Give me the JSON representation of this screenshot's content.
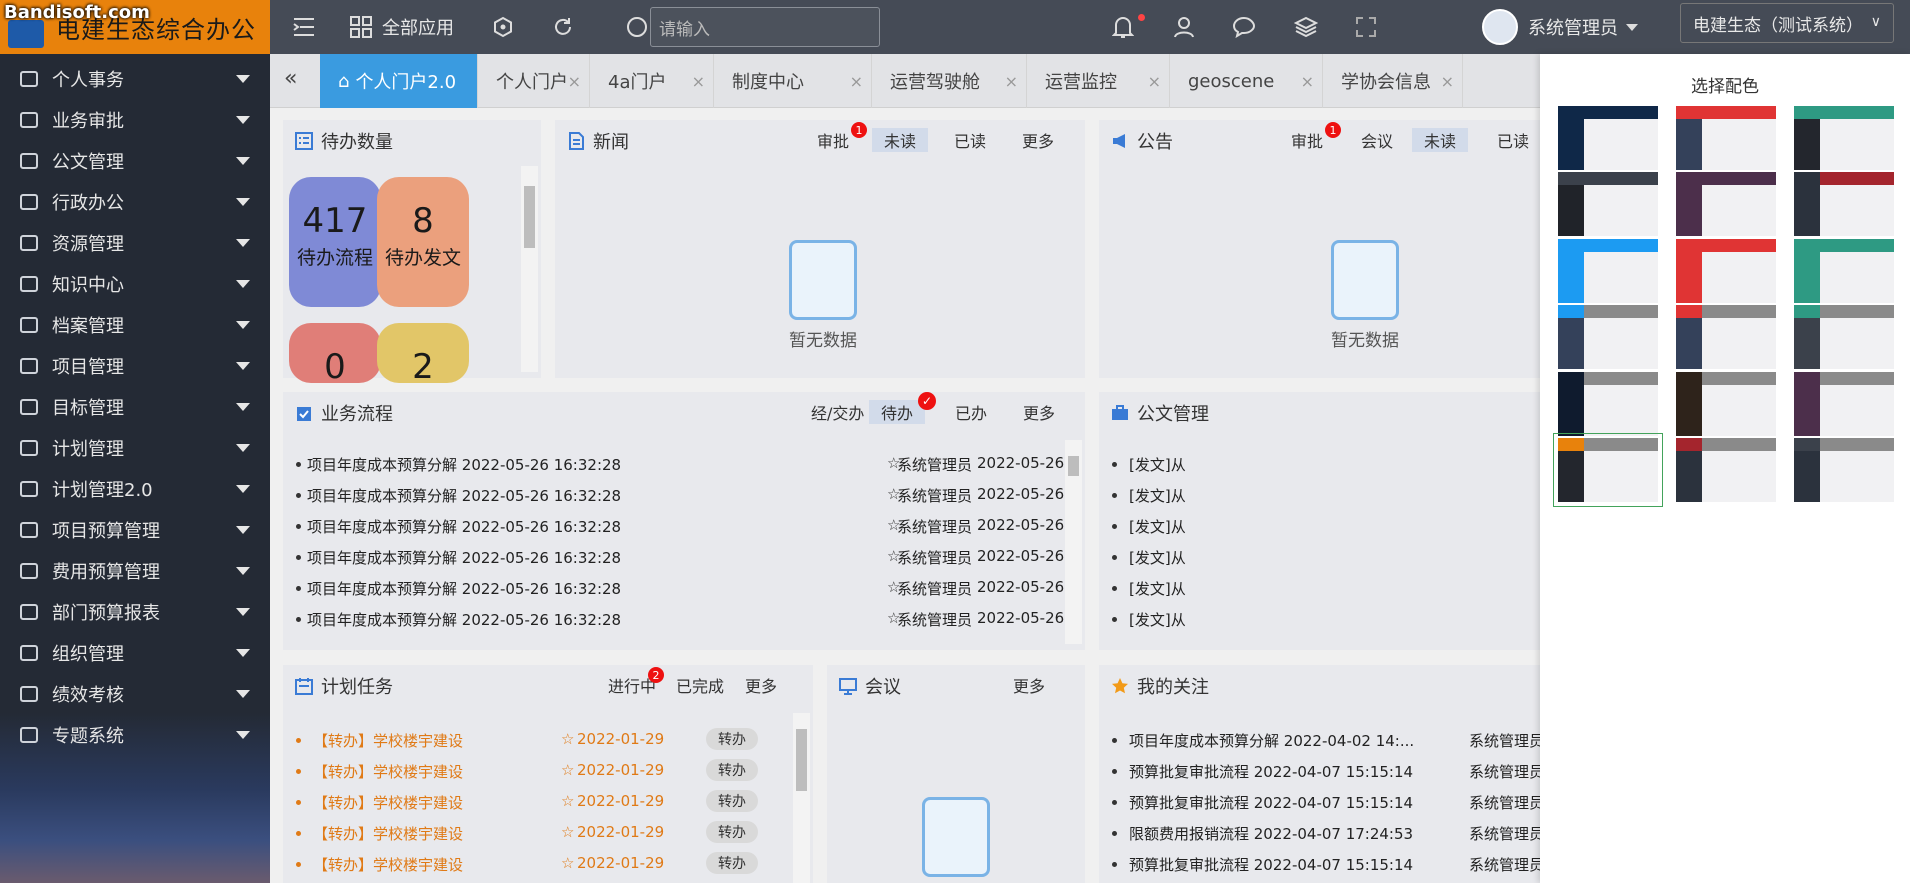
{
  "watermark": "Bandisoft.com",
  "app_title": "电建生态综合办公",
  "topbar": {
    "all_apps": "全部应用",
    "search_placeholder": "请输入",
    "user_name": "系统管理员",
    "system_select": "电建生态（测试系统）"
  },
  "sidebar": {
    "items": [
      {
        "label": "个人事务",
        "icon": "person-icon"
      },
      {
        "label": "业务审批",
        "icon": "approval-icon"
      },
      {
        "label": "公文管理",
        "icon": "document-icon"
      },
      {
        "label": "行政办公",
        "icon": "office-icon"
      },
      {
        "label": "资源管理",
        "icon": "target-icon"
      },
      {
        "label": "知识中心",
        "icon": "knowledge-icon"
      },
      {
        "label": "档案管理",
        "icon": "archive-icon"
      },
      {
        "label": "项目管理",
        "icon": "layers-icon"
      },
      {
        "label": "目标管理",
        "icon": "goal-icon"
      },
      {
        "label": "计划管理",
        "icon": "plan-icon"
      },
      {
        "label": "计划管理2.0",
        "icon": "plan2-icon"
      },
      {
        "label": "项目预算管理",
        "icon": "budget-icon"
      },
      {
        "label": "费用预算管理",
        "icon": "expense-icon"
      },
      {
        "label": "部门预算报表",
        "icon": "report-icon"
      },
      {
        "label": "组织管理",
        "icon": "org-icon"
      },
      {
        "label": "绩效考核",
        "icon": "kpi-icon"
      },
      {
        "label": "专题系统",
        "icon": "topic-icon"
      }
    ]
  },
  "tabs": [
    {
      "label": "个人门户2.0",
      "active": true
    },
    {
      "label": "个人门户"
    },
    {
      "label": "4a门户"
    },
    {
      "label": "制度中心"
    },
    {
      "label": "运营驾驶舱"
    },
    {
      "label": "运营监控"
    },
    {
      "label": "geoscene"
    },
    {
      "label": "学协会信息"
    }
  ],
  "pending": {
    "title": "待办数量",
    "tiles": [
      {
        "count": "417",
        "label": "待办流程",
        "color": "#7f8ad6"
      },
      {
        "count": "8",
        "label": "待办发文",
        "color": "#eba07d"
      },
      {
        "count": "0",
        "label": "",
        "color": "#e07e78"
      },
      {
        "count": "2",
        "label": "",
        "color": "#e2c668"
      }
    ]
  },
  "news": {
    "title": "新闻",
    "tabs": [
      "审批",
      "未读",
      "已读",
      "更多"
    ],
    "badge": "1",
    "empty": "暂无数据"
  },
  "notice": {
    "title": "公告",
    "tabs": [
      "审批",
      "会议",
      "未读",
      "已读"
    ],
    "badge": "1",
    "empty": "暂无数据"
  },
  "flow": {
    "title": "业务流程",
    "tabs": [
      "经/交办",
      "待办",
      "已办",
      "更多"
    ],
    "rows": [
      {
        "title": "项目年度成本预算分解 2022-05-26 16:32:28",
        "user": "系统管理员",
        "date": "2022-05-26"
      },
      {
        "title": "项目年度成本预算分解 2022-05-26 16:32:28",
        "user": "系统管理员",
        "date": "2022-05-26"
      },
      {
        "title": "项目年度成本预算分解 2022-05-26 16:32:28",
        "user": "系统管理员",
        "date": "2022-05-26"
      },
      {
        "title": "项目年度成本预算分解 2022-05-26 16:32:28",
        "user": "系统管理员",
        "date": "2022-05-26"
      },
      {
        "title": "项目年度成本预算分解 2022-05-26 16:32:28",
        "user": "系统管理员",
        "date": "2022-05-26"
      },
      {
        "title": "项目年度成本预算分解 2022-05-26 16:32:28",
        "user": "系统管理员",
        "date": "2022-05-26"
      }
    ]
  },
  "docs": {
    "title": "公文管理",
    "rows": [
      "[发文]从",
      "[发文]从",
      "[发文]从",
      "[发文]从",
      "[发文]从",
      "[发文]从"
    ]
  },
  "tasks": {
    "title": "计划任务",
    "tabs": [
      "进行中",
      "已完成",
      "更多"
    ],
    "badge": "2",
    "rows": [
      {
        "title": "【转办】学校楼宇建设",
        "date": "2022-01-29",
        "action": "转办"
      },
      {
        "title": "【转办】学校楼宇建设",
        "date": "2022-01-29",
        "action": "转办"
      },
      {
        "title": "【转办】学校楼宇建设",
        "date": "2022-01-29",
        "action": "转办"
      },
      {
        "title": "【转办】学校楼宇建设",
        "date": "2022-01-29",
        "action": "转办"
      },
      {
        "title": "【转办】学校楼宇建设",
        "date": "2022-01-29",
        "action": "转办"
      }
    ]
  },
  "meeting": {
    "title": "会议",
    "more": "更多"
  },
  "follow": {
    "title": "我的关注",
    "rows": [
      {
        "title": "项目年度成本预算分解 2022-04-02 14:...",
        "user": "系统管理员"
      },
      {
        "title": "预算批复审批流程 2022-04-07 15:15:14",
        "user": "系统管理员"
      },
      {
        "title": "预算批复审批流程 2022-04-07 15:15:14",
        "user": "系统管理员"
      },
      {
        "title": "限额费用报销流程 2022-04-07 17:24:53",
        "user": "系统管理员"
      },
      {
        "title": "预算批复审批流程 2022-04-07 15:15:14",
        "user": "系统管理员"
      }
    ]
  },
  "theme_panel": {
    "title": "选择配色",
    "selected_index": 15,
    "swatches": [
      {
        "side": "#0f2848",
        "top": "#0f2848",
        "corner": "#0f2848"
      },
      {
        "side": "#34415a",
        "top": "#e03434",
        "corner": "#e03434"
      },
      {
        "side": "#23262d",
        "top": "#2e9a83",
        "corner": "#2e9a83"
      },
      {
        "side": "#202329",
        "top": "#3b414b",
        "corner": "#3b414b"
      },
      {
        "side": "#4c2f4b",
        "top": "#4c2f4b",
        "corner": "#4c2f4b"
      },
      {
        "side": "#2b323d",
        "top": "#a4252d",
        "corner": "#2b323d"
      },
      {
        "side": "#1c9bf2",
        "top": "#1c9bf2",
        "corner": "#1c9bf2"
      },
      {
        "side": "#e03434",
        "top": "#e03434",
        "corner": "#e03434"
      },
      {
        "side": "#2e9a83",
        "top": "#2e9a83",
        "corner": "#2e9a83"
      },
      {
        "side": "#34415a",
        "top": "#8a8a8a",
        "corner": "#1c9bf2"
      },
      {
        "side": "#34415a",
        "top": "#8a8a8a",
        "corner": "#e03434"
      },
      {
        "side": "#3b414b",
        "top": "#8a8a8a",
        "corner": "#2e9a83"
      },
      {
        "side": "#0f1b2e",
        "top": "#8a8a8a",
        "corner": "#0f1b2e"
      },
      {
        "side": "#2e231b",
        "top": "#8a8a8a",
        "corner": "#2e231b"
      },
      {
        "side": "#4c2f4b",
        "top": "#8a8a8a",
        "corner": "#4c2f4b"
      },
      {
        "side": "#23262d",
        "top": "#8a8a8a",
        "corner": "#e8820c"
      },
      {
        "side": "#2b323d",
        "top": "#8a8a8a",
        "corner": "#a4252d"
      },
      {
        "side": "#2b323d",
        "top": "#8a8a8a",
        "corner": "#3b414b"
      }
    ]
  }
}
